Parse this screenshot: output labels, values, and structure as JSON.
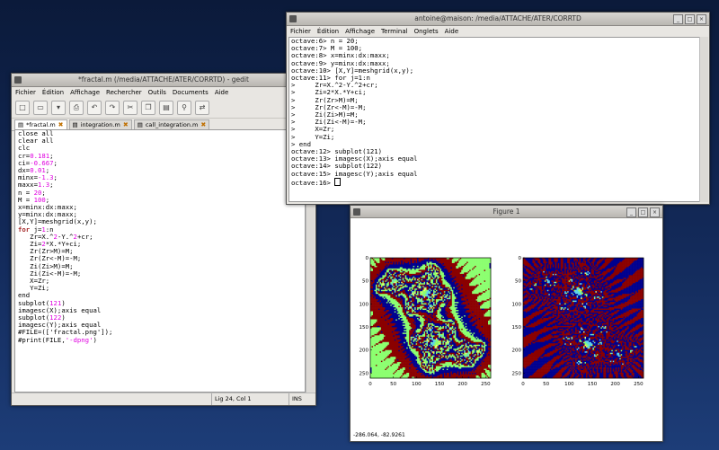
{
  "gedit": {
    "title": "*fractal.m (/media/ATTACHE/ATER/CORRTD) - gedit",
    "menu": [
      "Fichier",
      "Édition",
      "Affichage",
      "Rechercher",
      "Outils",
      "Documents",
      "Aide"
    ],
    "tabs": [
      {
        "label": "*fractal.m",
        "active": true
      },
      {
        "label": "integration.m",
        "active": false
      },
      {
        "label": "call_integration.m",
        "active": false
      }
    ],
    "code": [
      [
        [
          "close all",
          ""
        ]
      ],
      [
        [
          "clear all",
          ""
        ]
      ],
      [
        [
          "clc",
          ""
        ]
      ],
      [
        [
          "cr=",
          ""
        ],
        [
          "0.181",
          "num"
        ],
        [
          ";",
          ""
        ]
      ],
      [
        [
          "ci=",
          ""
        ],
        [
          "-0.667",
          "num"
        ],
        [
          ";",
          ""
        ]
      ],
      [
        [
          "dx=",
          ""
        ],
        [
          "0.01",
          "num"
        ],
        [
          ";",
          ""
        ]
      ],
      [
        [
          "minx=",
          ""
        ],
        [
          "-1.3",
          "num"
        ],
        [
          ";",
          ""
        ]
      ],
      [
        [
          "maxx=",
          ""
        ],
        [
          "1.3",
          "num"
        ],
        [
          ";",
          ""
        ]
      ],
      [
        [
          "n = ",
          ""
        ],
        [
          "20",
          "num"
        ],
        [
          ";",
          ""
        ]
      ],
      [
        [
          "M = ",
          ""
        ],
        [
          "100",
          "num"
        ],
        [
          ";",
          ""
        ]
      ],
      [
        [
          "x=minx:dx:maxx;",
          ""
        ]
      ],
      [
        [
          "y=minx:dx:maxx;",
          ""
        ]
      ],
      [
        [
          "[X,Y]=meshgrid(x,y);",
          ""
        ]
      ],
      [
        [
          "for",
          "kw"
        ],
        [
          " j=",
          ""
        ],
        [
          "1",
          "num"
        ],
        [
          ":n",
          ""
        ]
      ],
      [
        [
          "   Zr=X.^",
          ""
        ],
        [
          "2",
          "num"
        ],
        [
          "-Y.^",
          ""
        ],
        [
          "2",
          "num"
        ],
        [
          "+cr;",
          ""
        ]
      ],
      [
        [
          "   Zi=",
          ""
        ],
        [
          "2",
          "num"
        ],
        [
          "*X.*Y+ci;",
          ""
        ]
      ],
      [
        [
          "   Zr(Zr>M)=M;",
          ""
        ]
      ],
      [
        [
          "   Zr(Zr<-M)=-M;",
          ""
        ]
      ],
      [
        [
          "   Zi(Zi>M)=M;",
          ""
        ]
      ],
      [
        [
          "   Zi(Zi<-M)=-M;",
          ""
        ]
      ],
      [
        [
          "   X=Zr;",
          ""
        ]
      ],
      [
        [
          "   Y=Zi;",
          ""
        ]
      ],
      [
        [
          "end",
          ""
        ]
      ],
      [
        [
          "subplot(",
          ""
        ],
        [
          "121",
          "num"
        ],
        [
          ")",
          ""
        ]
      ],
      [
        [
          "imagesc(X);axis equal",
          ""
        ]
      ],
      [
        [
          "subplot(",
          ""
        ],
        [
          "122",
          "num"
        ],
        [
          ")",
          ""
        ]
      ],
      [
        [
          "imagesc(Y);axis equal",
          ""
        ]
      ],
      [
        [
          "#FILE=(['fractal.png']);",
          ""
        ]
      ],
      [
        [
          "#print(FILE,",
          ""
        ],
        [
          "'-dpng'",
          "str"
        ],
        [
          ")",
          ""
        ]
      ]
    ],
    "status": {
      "position": "Lig 24, Col 1",
      "mode": "INS"
    }
  },
  "terminal": {
    "title": "antoine@maison: /media/ATTACHE/ATER/CORRTD",
    "menu": [
      "Fichier",
      "Édition",
      "Affichage",
      "Terminal",
      "Onglets",
      "Aide"
    ],
    "lines": [
      "octave:6> n = 20;",
      "octave:7> M = 100;",
      "octave:8> x=minx:dx:maxx;",
      "octave:9> y=minx:dx:maxx;",
      "octave:10> [X,Y]=meshgrid(x,y);",
      "octave:11> for j=1:n",
      ">     Zr=X.^2-Y.^2+cr;",
      ">     Zi=2*X.*Y+ci;",
      ">     Zr(Zr>M)=M;",
      ">     Zr(Zr<-M)=-M;",
      ">     Zi(Zi>M)=M;",
      ">     Zi(Zi<-M)=-M;",
      ">     X=Zr;",
      ">     Y=Zi;",
      "> end",
      "octave:12> subplot(121)",
      "octave:13> imagesc(X);axis equal",
      "octave:14> subplot(122)",
      "octave:15> imagesc(Y);axis equal",
      "octave:16> "
    ]
  },
  "figure": {
    "title": "Figure 1",
    "coords": "-286.064, -82.9261",
    "colors": {
      "red": "#8b0000",
      "cyan": "#5fd3e8",
      "green": "#8cff70",
      "blue": "#00008f",
      "yellow": "#ffff60"
    }
  },
  "chart_data": [
    {
      "type": "heatmap",
      "title": "",
      "x_ticks": [
        "0",
        "50",
        "100",
        "150",
        "200",
        "250"
      ],
      "y_ticks": [
        "0",
        "50",
        "100",
        "150",
        "200",
        "250"
      ],
      "xlim": [
        0,
        261
      ],
      "ylim": [
        0,
        261
      ]
    },
    {
      "type": "heatmap",
      "title": "",
      "x_ticks": [
        "0",
        "50",
        "100",
        "150",
        "200",
        "250"
      ],
      "y_ticks": [
        "0",
        "50",
        "100",
        "150",
        "200",
        "250"
      ],
      "xlim": [
        0,
        261
      ],
      "ylim": [
        0,
        261
      ]
    }
  ]
}
